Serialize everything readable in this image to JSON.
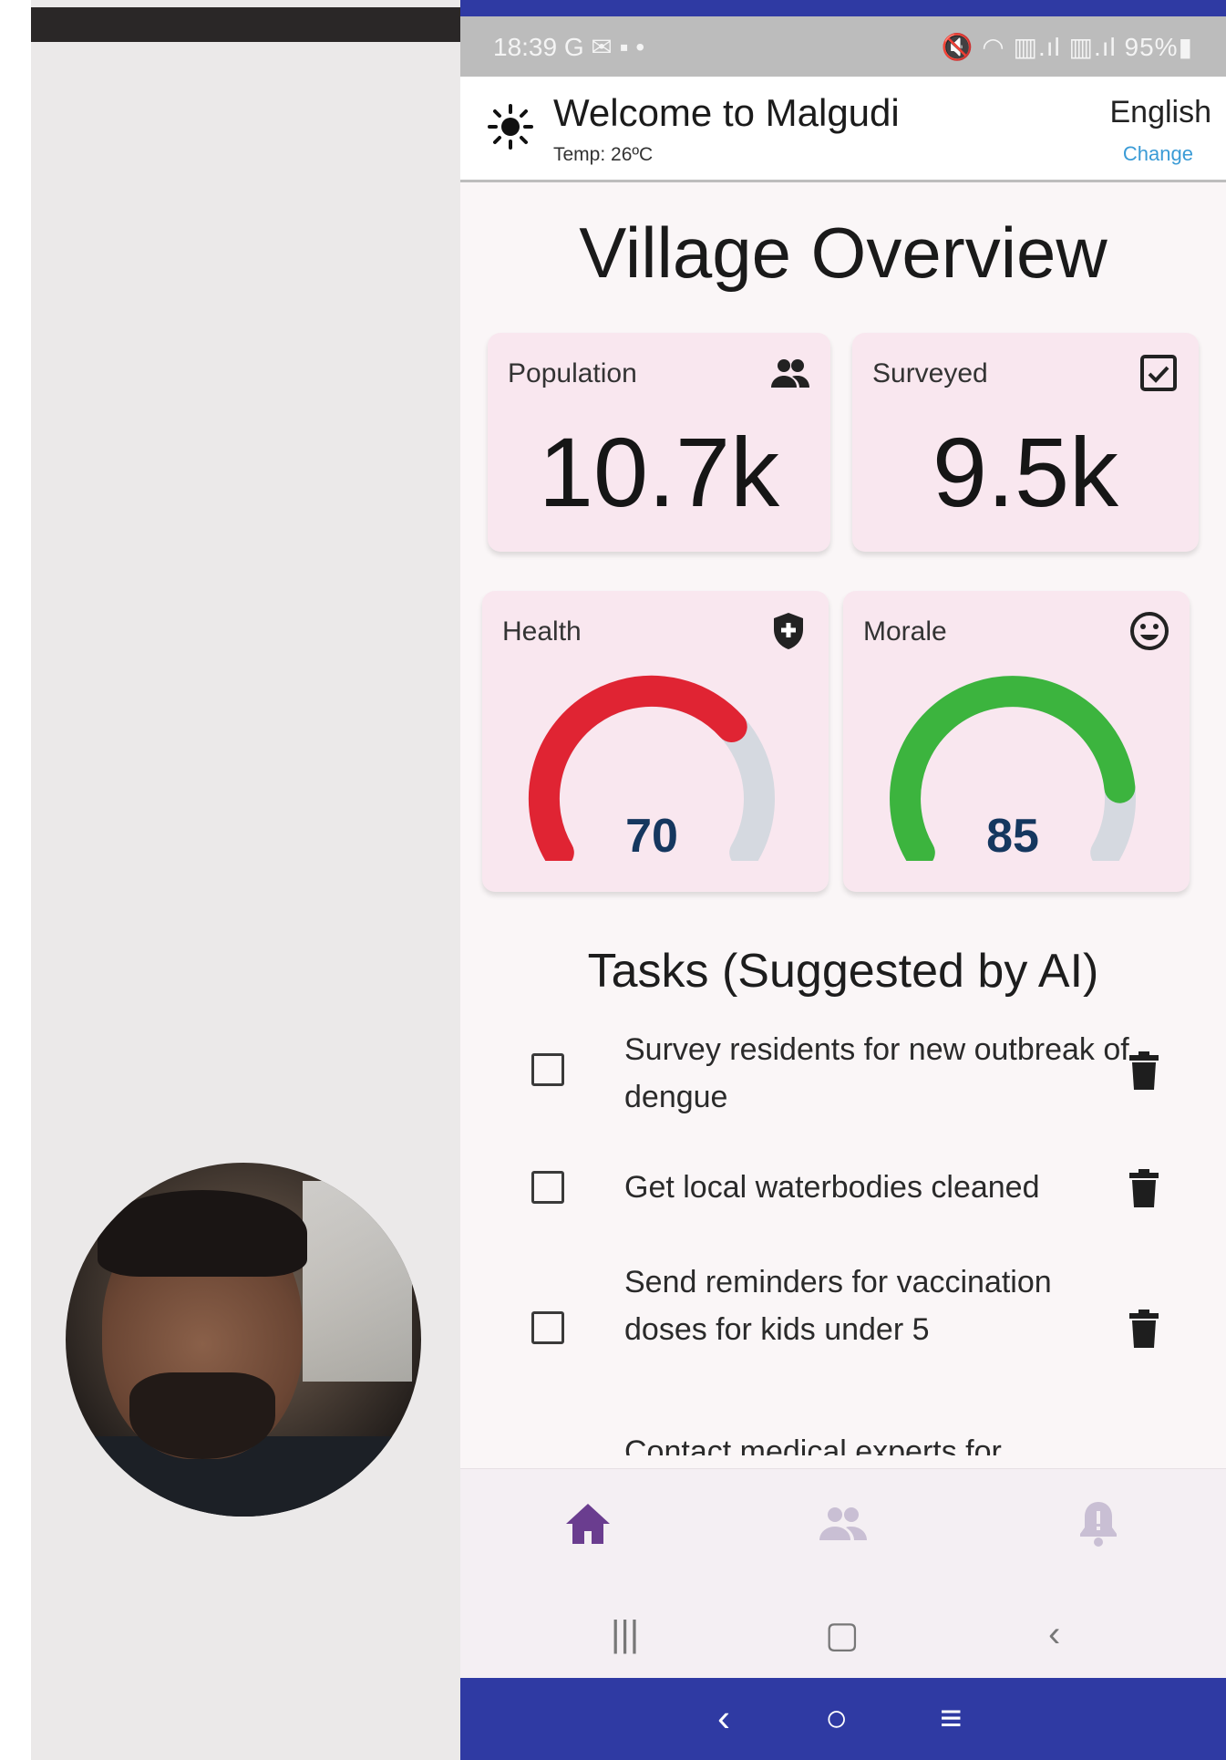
{
  "status": {
    "time": "18:39 G ✉ ▪ •",
    "right": "🔇 ◠ ▥.ıl ▥.ıl 95%▮"
  },
  "header": {
    "title": "Welcome to Malgudi",
    "temp": "Temp: 26ºC",
    "language": "English",
    "change_label": "Change"
  },
  "page_title": "Village Overview",
  "stats": [
    {
      "label": "Population",
      "value": "10.7k",
      "icon": "people-icon"
    },
    {
      "label": "Surveyed",
      "value": "9.5k",
      "icon": "checkbox-checked-icon"
    }
  ],
  "gauges": [
    {
      "label": "Health",
      "value": "70",
      "level": 0.7,
      "color": "#e02433",
      "icon": "shield-plus-icon"
    },
    {
      "label": "Morale",
      "value": "85",
      "level": 0.85,
      "color": "#3cb43e",
      "icon": "smiley-icon"
    }
  ],
  "tasks_title": "Tasks (Suggested by AI)",
  "tasks": [
    {
      "text": "Survey residents for new outbreak of dengue",
      "checked": false
    },
    {
      "text": "Get local waterbodies cleaned",
      "checked": false
    },
    {
      "text": "Send reminders for vaccination doses for kids under 5",
      "checked": false
    },
    {
      "text": "Contact medical experts for",
      "checked": false
    }
  ],
  "nav": [
    "home-icon",
    "people-icon",
    "bell-alert-icon"
  ],
  "colors": {
    "accent": "#6a3d8f",
    "gauge_track": "#d5d9e0",
    "gauge_value": "#15375f",
    "bluebar": "#2f3aa3"
  }
}
